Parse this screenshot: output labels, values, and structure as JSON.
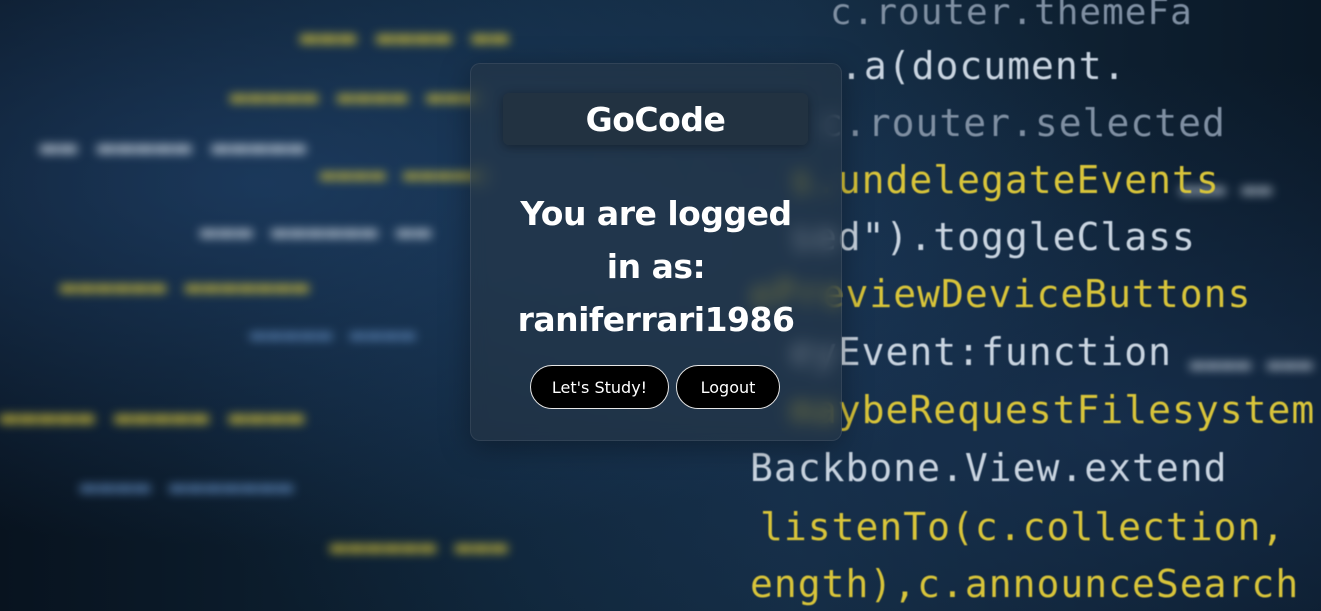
{
  "app": {
    "brand": "GoCode"
  },
  "login_status": {
    "line1": "You are logged",
    "line2": "in as:",
    "username": "raniferrari1986"
  },
  "actions": {
    "study_label": "Let's Study!",
    "logout_label": "Logout"
  },
  "background": {
    "code_lines": [
      "c.router.themeFa",
      ".a(document.",
      "c.router.selected",
      "s.undelegateEvents",
      "sed\").toggleClass",
      "ePreviewDeviceButtons",
      "eyEvent:function",
      "maybeRequestFilesystem",
      "Backbone.View.extend",
      "listenTo(c.collection,",
      "ength),c.announceSearch"
    ]
  },
  "colors": {
    "card_bg": "#2837465c",
    "button_bg": "#000000",
    "button_border": "#e6e6e6",
    "text": "#ffffff"
  }
}
